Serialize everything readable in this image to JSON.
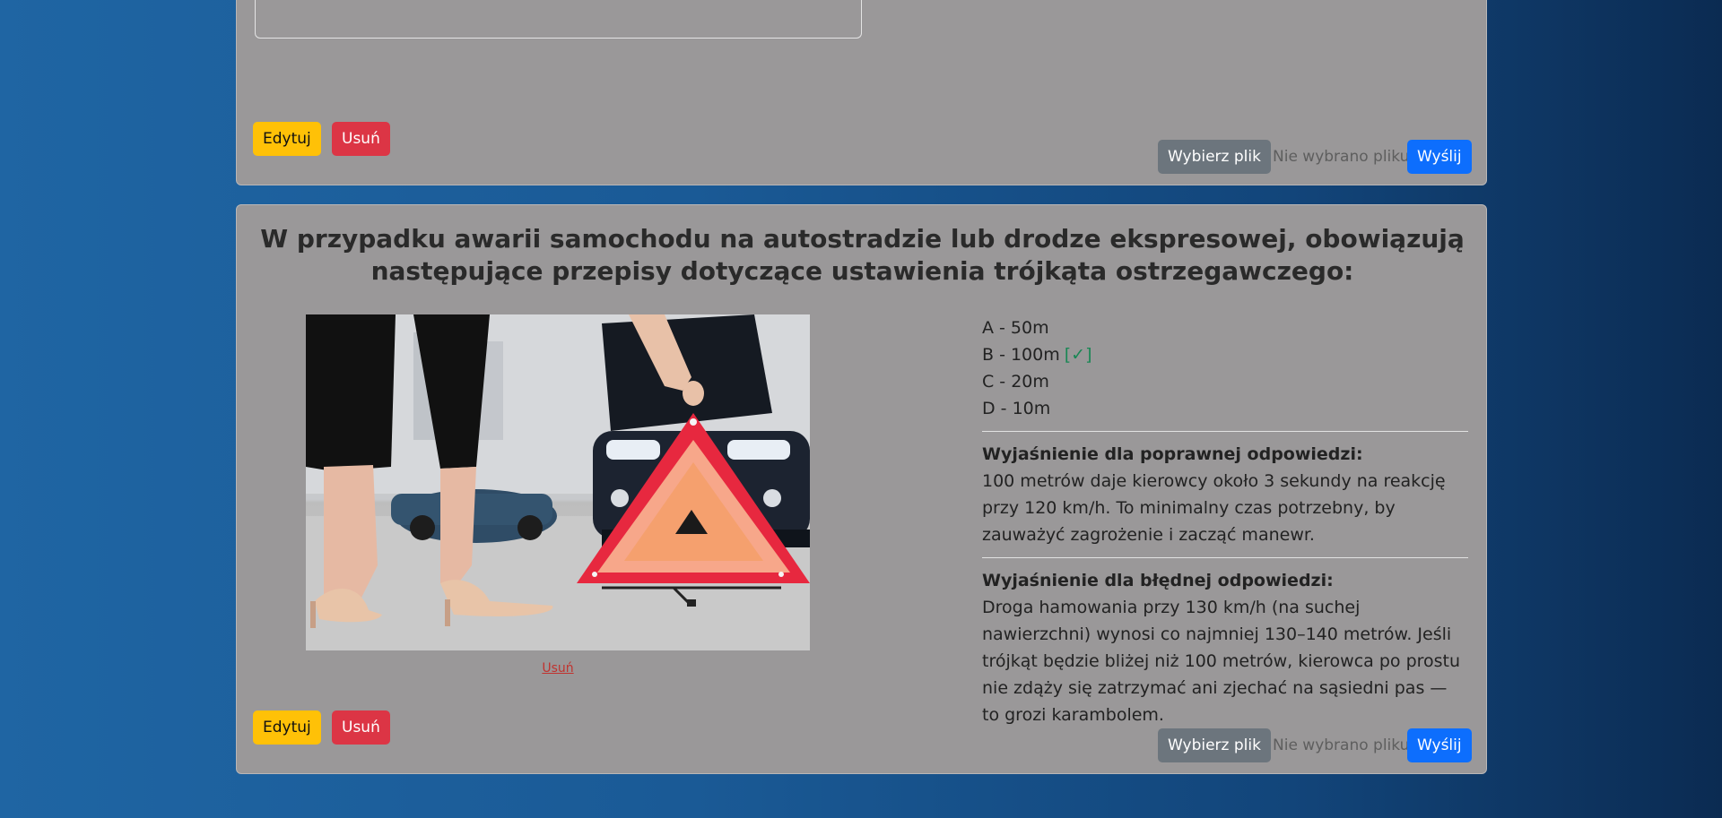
{
  "card_top": {
    "edit_label": "Edytuj",
    "delete_label": "Usuń",
    "choose_file_label": "Wybierz plik",
    "no_file_label": "Nie wybrano pliku",
    "send_label": "Wyślij"
  },
  "card_question": {
    "title": "W przypadku awarii samochodu na autostradzie lub drodze ekspresowej, obowiązują następujące przepisy dotyczące ustawienia trójkąta ostrzegawczego:",
    "image_remove_label": "Usuń",
    "answers": [
      {
        "text": "A - 50m",
        "correct": false
      },
      {
        "text": "B - 100m",
        "correct": true,
        "mark": "[✓]"
      },
      {
        "text": "C - 20m",
        "correct": false
      },
      {
        "text": "D - 10m",
        "correct": false
      }
    ],
    "correct_explanation_title": "Wyjaśnienie dla poprawnej odpowiedzi:",
    "correct_explanation_text": "100 metrów daje kierowcy około 3 sekundy na reakcję przy 120 km/h. To minimalny czas potrzebny, by zauważyć zagrożenie i zacząć manewr.",
    "wrong_explanation_title": "Wyjaśnienie dla błędnej odpowiedzi:",
    "wrong_explanation_text": "Droga hamowania przy 130 km/h (na suchej nawierzchni) wynosi co najmniej 130–140 metrów. Jeśli trójkąt będzie bliżej niż 100 metrów, kierowca po prostu nie zdąży się zatrzymać ani zjechać na sąsiedni pas — to grozi karambolem.",
    "edit_label": "Edytuj",
    "delete_label": "Usuń",
    "choose_file_label": "Wybierz plik",
    "no_file_label": "Nie wybrano pliku",
    "send_label": "Wyślij"
  },
  "colors": {
    "card_bg": "#9a9899",
    "edit": "#ffc107",
    "delete": "#dc3545",
    "choose": "#6c757d",
    "send": "#0d6efd",
    "check": "#198754"
  },
  "icons": [
    "warning-triangle-photo"
  ]
}
